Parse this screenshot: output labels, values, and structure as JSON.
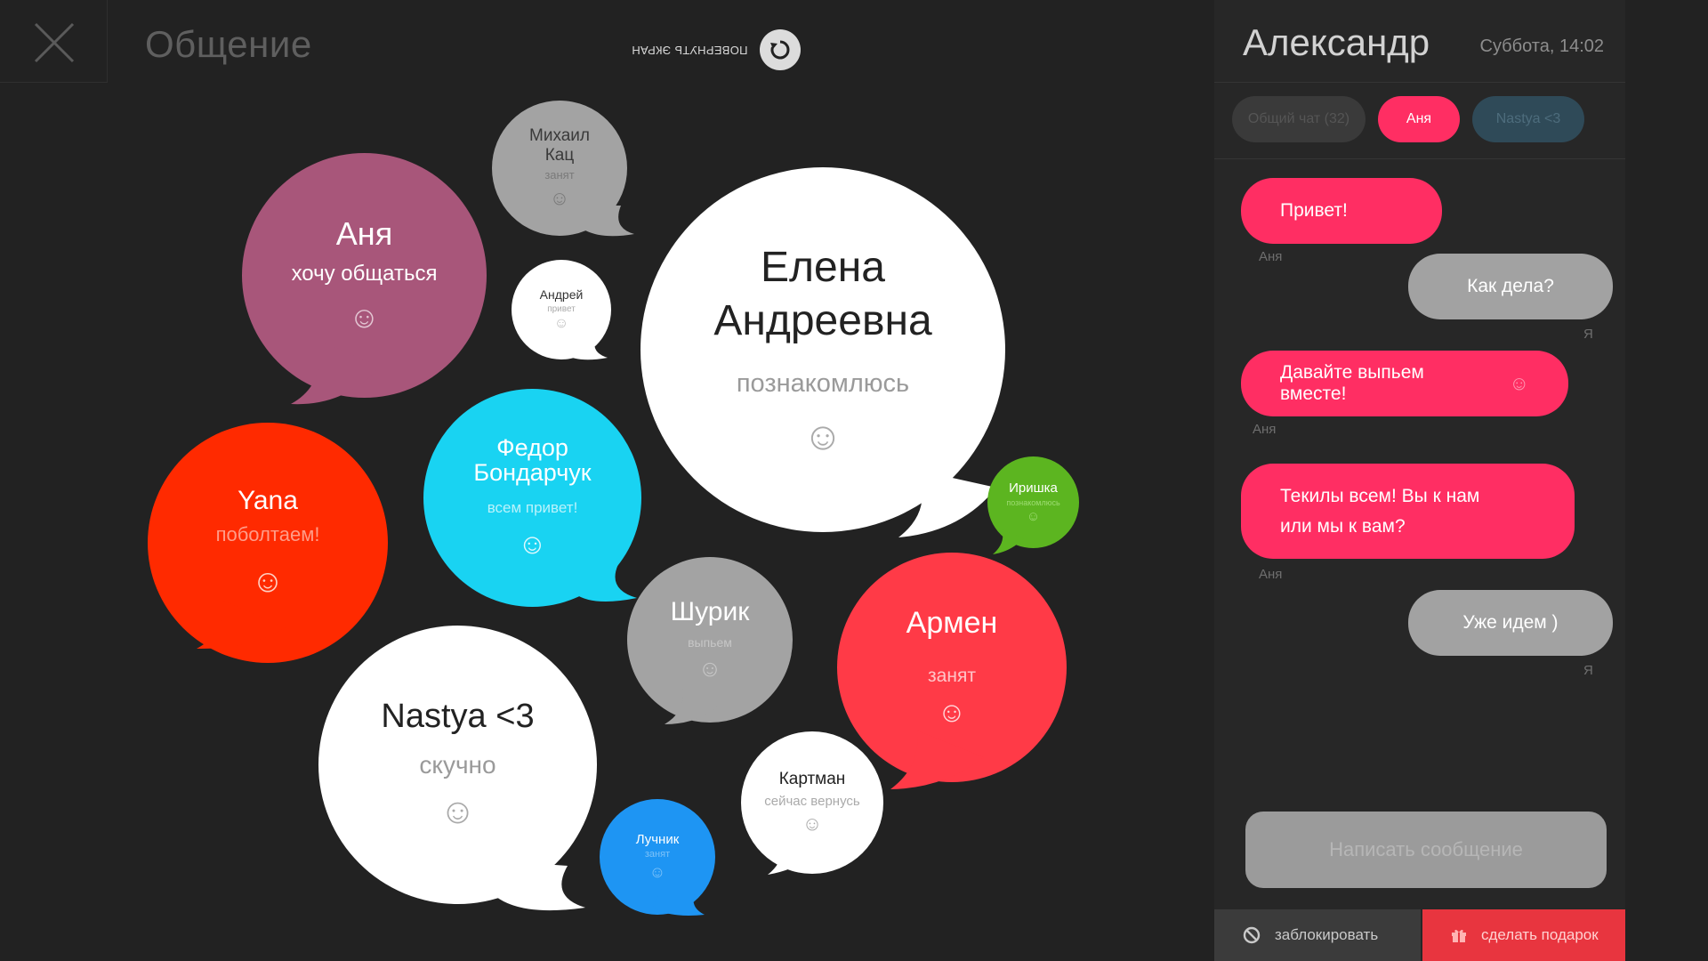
{
  "header": {
    "title": "Общение",
    "rotate_label": "ПОВЕРНУТЬ ЭКРАН",
    "close_icon": "close-icon",
    "rotate_icon": "rotate-icon"
  },
  "bubbles": [
    {
      "name": "Михаил Кац",
      "status": "занят",
      "color": "#a3a3a3"
    },
    {
      "name": "Аня",
      "status": "хочу общаться",
      "color": "#a8567a"
    },
    {
      "name": "Андрей",
      "status": "привет",
      "color": "#ffffff"
    },
    {
      "name": "Елена Андреевна",
      "status": "познакомлюсь",
      "color": "#ffffff"
    },
    {
      "name": "Федор Бондарчук",
      "status": "всем привет!",
      "color": "#19d3f2"
    },
    {
      "name": "Иришка",
      "status": "познакомлюсь",
      "color": "#5cb520"
    },
    {
      "name": "Yana",
      "status": "поболтаем!",
      "color": "#ff2a00"
    },
    {
      "name": "Шурик",
      "status": "выпьем",
      "color": "#a3a3a3"
    },
    {
      "name": "Армен",
      "status": "занят",
      "color": "#ff3a47"
    },
    {
      "name": "Nastya <3",
      "status": "скучно",
      "color": "#ffffff"
    },
    {
      "name": "Картман",
      "status": "сейчас вернусь",
      "color": "#ffffff"
    },
    {
      "name": "Лучник",
      "status": "занят",
      "color": "#1e95f3"
    }
  ],
  "chat": {
    "user_name": "Александр",
    "datetime": "Суббота, 14:02",
    "tabs": [
      {
        "label": "Общий чат (32)"
      },
      {
        "label": "Аня"
      },
      {
        "label": "Nastya <3"
      }
    ],
    "messages": [
      {
        "text": "Привет!",
        "sender": "Аня"
      },
      {
        "text": "Как дела?",
        "sender": "Я"
      },
      {
        "text": "Давайте выпьем вместе!",
        "sender": "Аня"
      },
      {
        "text": "Текилы всем! Вы к нам или мы к вам?",
        "sender": "Аня"
      },
      {
        "text": "Уже идем )",
        "sender": "Я"
      }
    ],
    "compose_placeholder": "Написать сообщение",
    "block_label": "заблокировать",
    "gift_label": "сделать подарок"
  }
}
